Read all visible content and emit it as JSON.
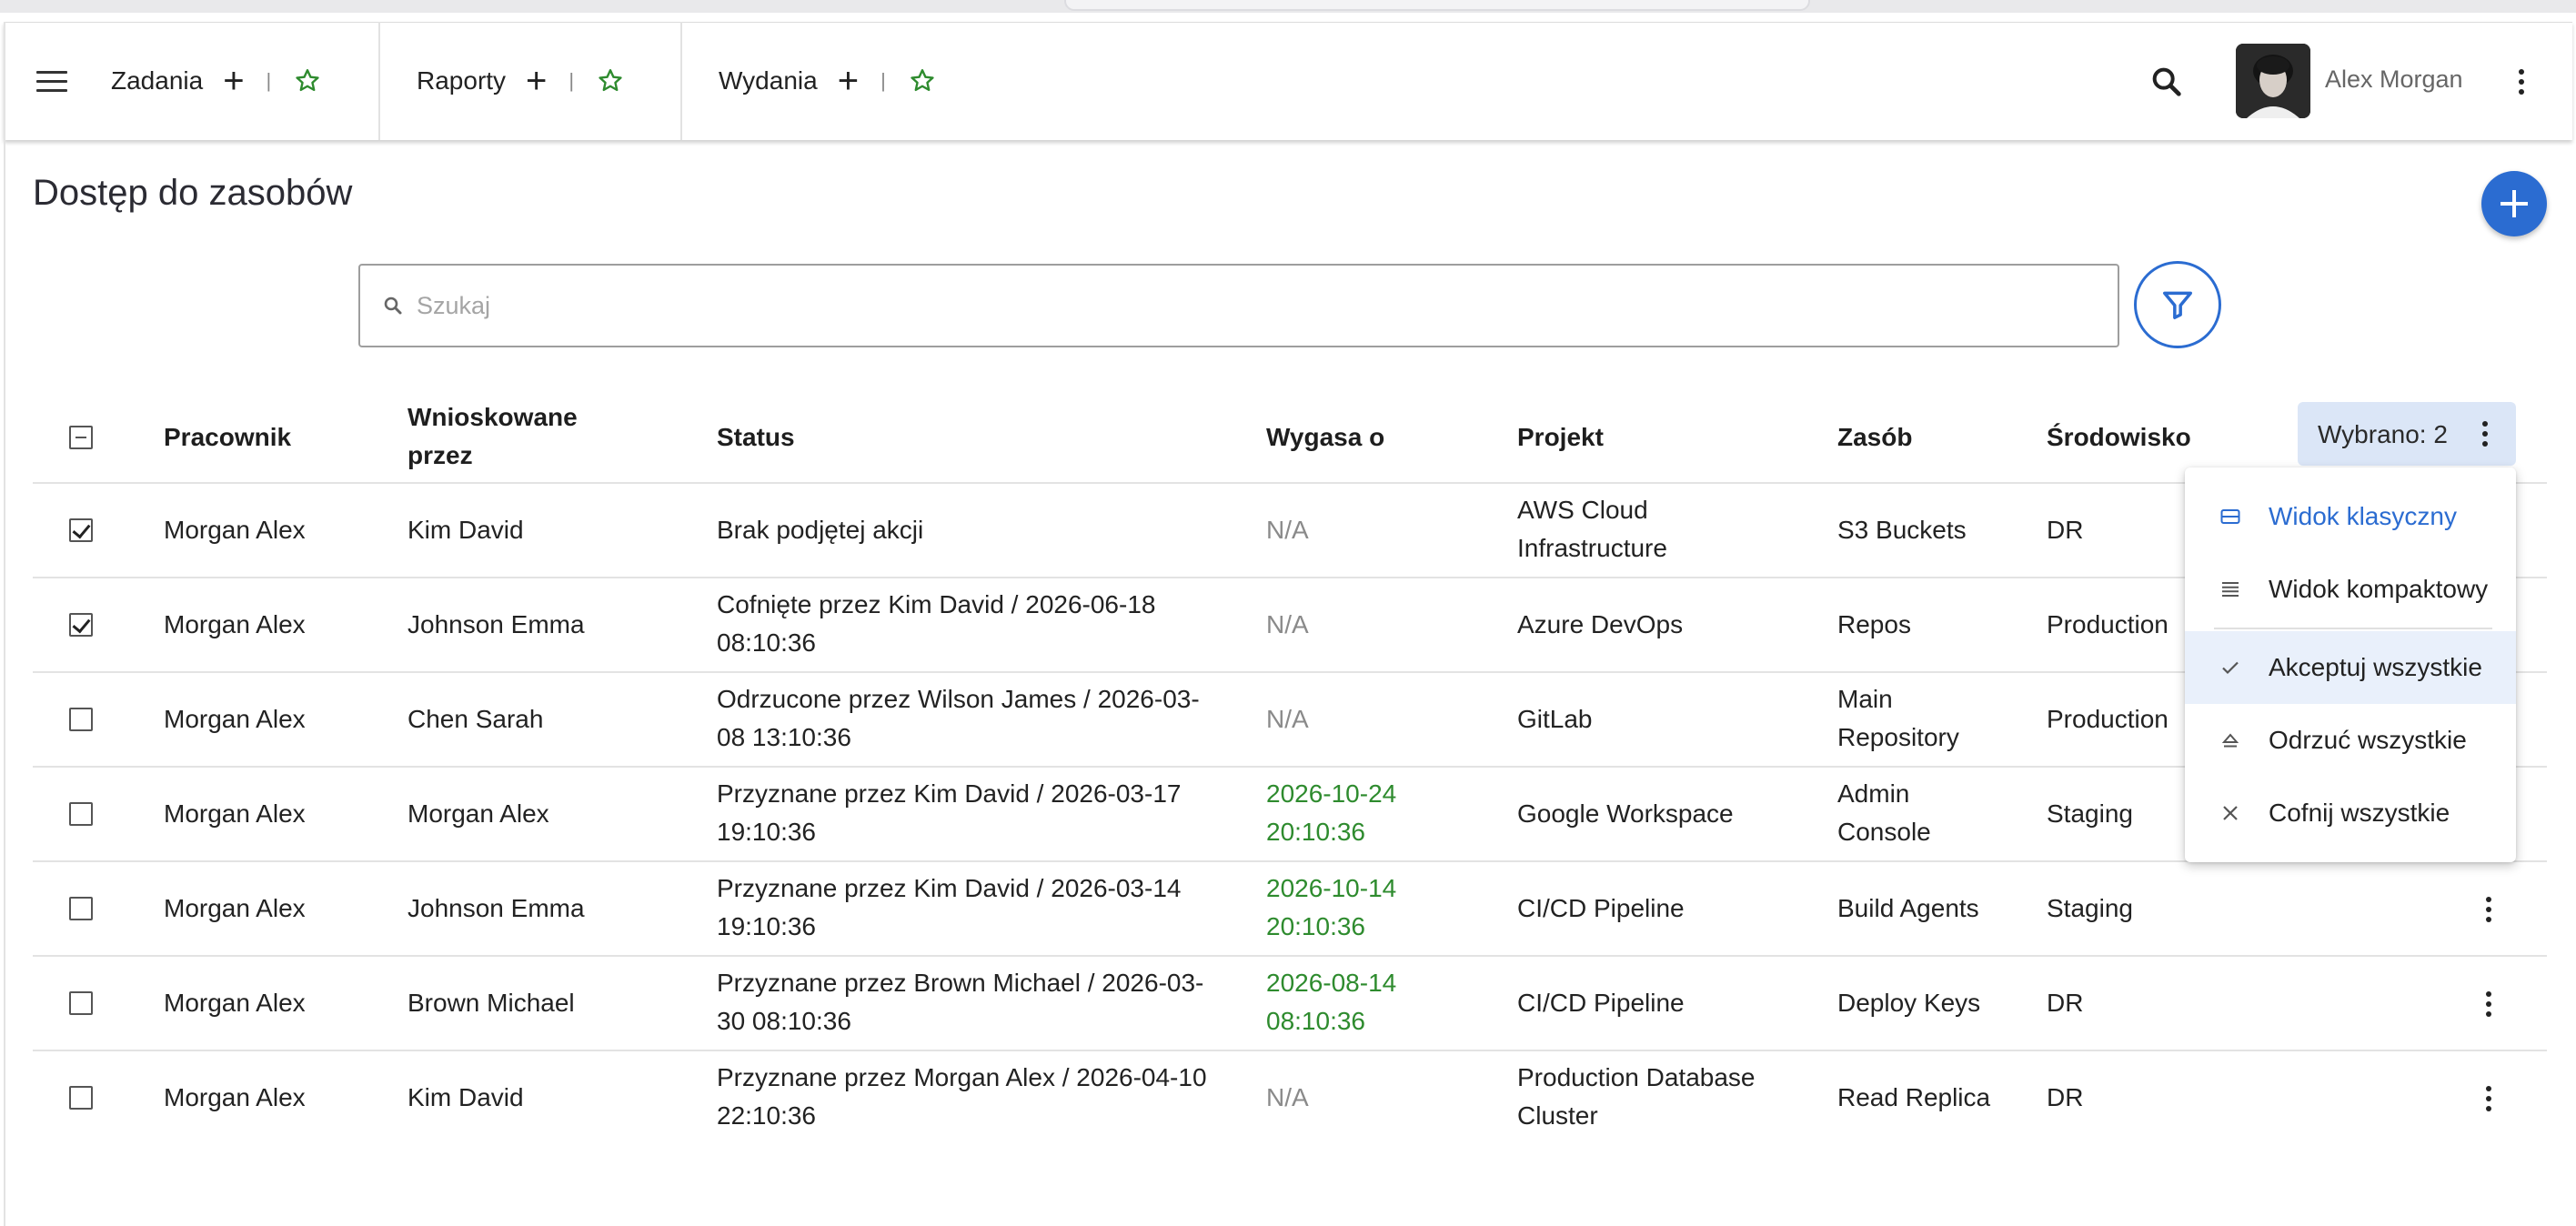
{
  "appbar": {
    "tabs": [
      {
        "label": "Zadania"
      },
      {
        "label": "Raporty"
      },
      {
        "label": "Wydania"
      }
    ],
    "user_name": "Alex Morgan"
  },
  "page": {
    "title": "Dostęp do zasobów",
    "search_placeholder": "Szukaj"
  },
  "table": {
    "headers": {
      "employee": "Pracownik",
      "requested_by": "Wnioskowane przez",
      "status": "Status",
      "expires": "Wygasa o",
      "project": "Projekt",
      "resource": "Zasób",
      "environment": "Środowisko"
    },
    "selected_label": "Wybrano: 2",
    "rows": [
      {
        "checked": true,
        "employee": "Morgan Alex",
        "requested_by": "Kim David",
        "status": "Brak podjętej akcji",
        "expires": "N/A",
        "project": "AWS Cloud Infrastructure",
        "resource": "S3 Buckets",
        "environment": "DR"
      },
      {
        "checked": true,
        "employee": "Morgan Alex",
        "requested_by": "Johnson Emma",
        "status": "Cofnięte przez Kim David / 2026-06-18 08:10:36",
        "expires": "N/A",
        "project": "Azure DevOps",
        "resource": "Repos",
        "environment": "Production"
      },
      {
        "checked": false,
        "employee": "Morgan Alex",
        "requested_by": "Chen Sarah",
        "status": "Odrzucone przez Wilson James / 2026-03-08 13:10:36",
        "expires": "N/A",
        "project": "GitLab",
        "resource": "Main Repository",
        "environment": "Production"
      },
      {
        "checked": false,
        "employee": "Morgan Alex",
        "requested_by": "Morgan Alex",
        "status": "Przyznane przez Kim David / 2026-03-17 19:10:36",
        "expires": "2026-10-24 20:10:36",
        "project": "Google Workspace",
        "resource": "Admin Console",
        "environment": "Staging"
      },
      {
        "checked": false,
        "employee": "Morgan Alex",
        "requested_by": "Johnson Emma",
        "status": "Przyznane przez Kim David / 2026-03-14 19:10:36",
        "expires": "2026-10-14 20:10:36",
        "project": "CI/CD Pipeline",
        "resource": "Build Agents",
        "environment": "Staging"
      },
      {
        "checked": false,
        "employee": "Morgan Alex",
        "requested_by": "Brown Michael",
        "status": "Przyznane przez Brown Michael / 2026-03-30 08:10:36",
        "expires": "2026-08-14 08:10:36",
        "project": "CI/CD Pipeline",
        "resource": "Deploy Keys",
        "environment": "DR"
      },
      {
        "checked": false,
        "employee": "Morgan Alex",
        "requested_by": "Kim David",
        "status": "Przyznane przez Morgan Alex / 2026-04-10 22:10:36",
        "expires": "N/A",
        "project": "Production Database Cluster",
        "resource": "Read Replica",
        "environment": "DR"
      }
    ]
  },
  "menu": {
    "items": [
      {
        "label": "Widok klasyczny",
        "icon": "classic-view-icon"
      },
      {
        "label": "Widok kompaktowy",
        "icon": "compact-view-icon"
      },
      {
        "label": "Akceptuj wszystkie",
        "icon": "check-icon"
      },
      {
        "label": "Odrzuć wszystkie",
        "icon": "eject-icon"
      },
      {
        "label": "Cofnij wszystkie",
        "icon": "close-icon"
      }
    ]
  },
  "colors": {
    "accent": "#2b6cd1",
    "star": "#2e8b2e",
    "date_green": "#2e8b2e",
    "selected_chip": "#dbe6f7"
  }
}
